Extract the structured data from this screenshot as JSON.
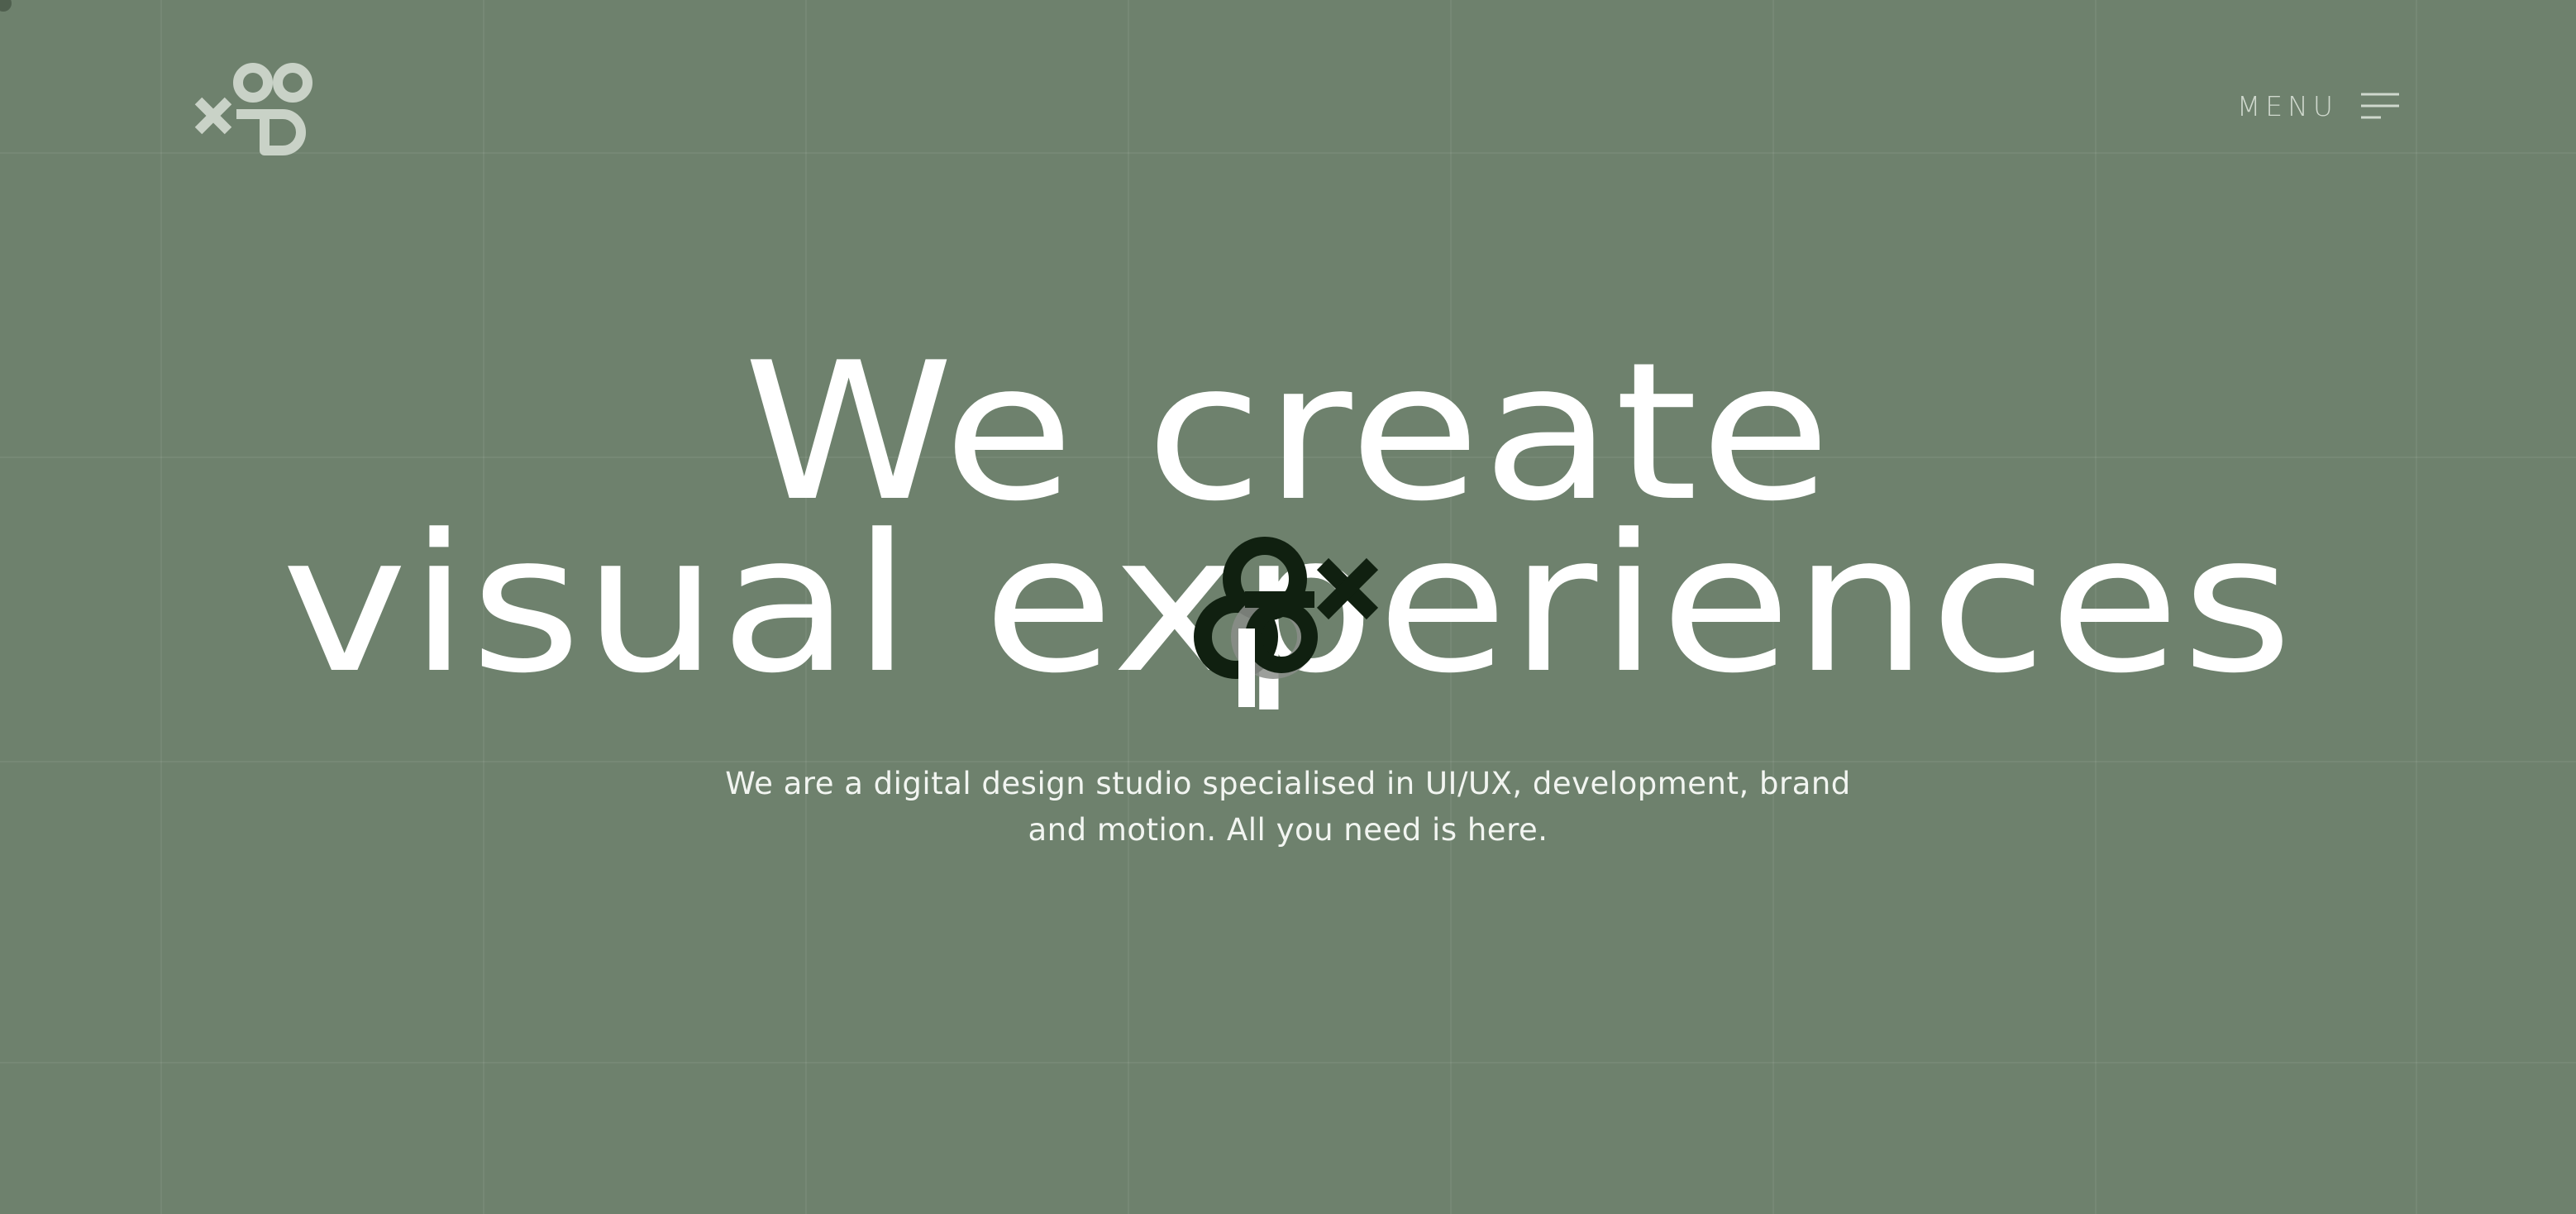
{
  "header": {
    "logo_icon": "studio-logo-x-oo-p-icon",
    "menu_label": "MENU",
    "menu_icon": "hamburger-menu-icon"
  },
  "hero": {
    "headline_line1": "We create",
    "headline_line2": "visual experiences",
    "subtitle": "We are a digital design studio specialised in UI/UX, development, brand and motion. All you need is here.",
    "center_mark_icon": "animated-logo-mark-icon"
  },
  "colors": {
    "background": "#6e816d",
    "text": "#ffffff",
    "logo_light": "#c9d2c7",
    "mark_dark": "#102010",
    "mark_gray": "#8b8e89"
  }
}
